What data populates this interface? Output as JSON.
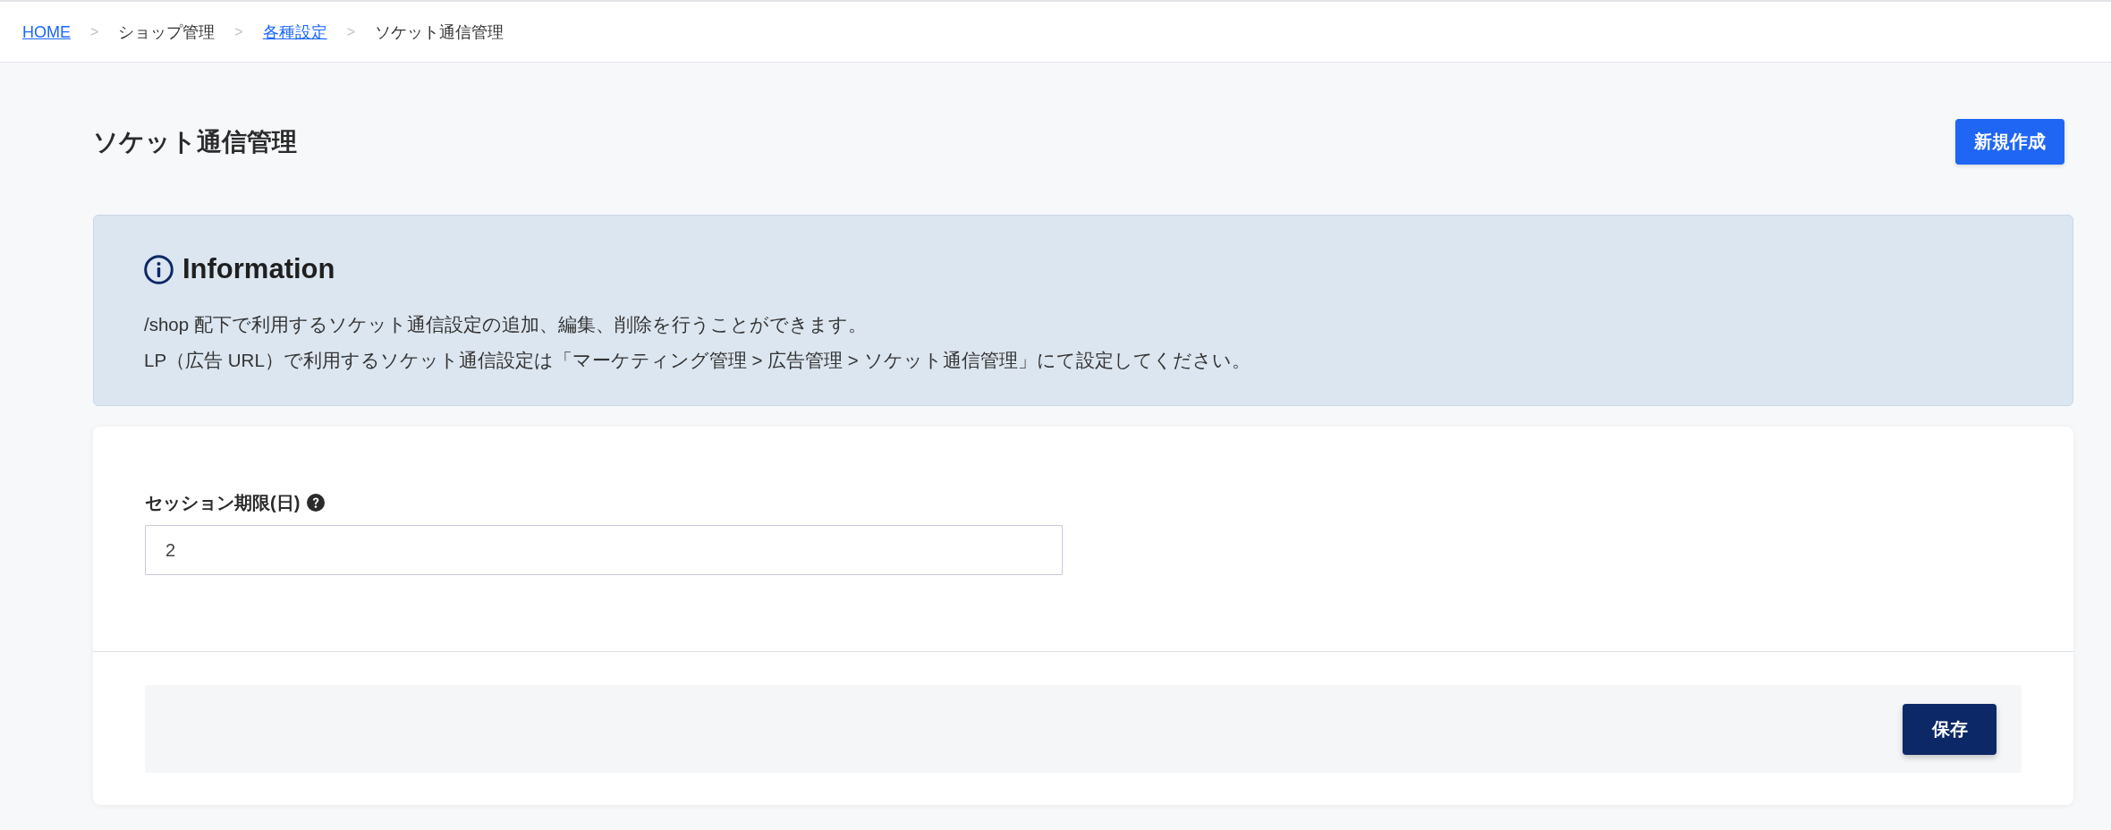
{
  "breadcrumb": [
    {
      "kind": "link",
      "label": "HOME"
    },
    {
      "kind": "separator",
      "label": ">"
    },
    {
      "kind": "text",
      "label": "ショップ管理"
    },
    {
      "kind": "separator",
      "label": ">"
    },
    {
      "kind": "link",
      "label": "各種設定"
    },
    {
      "kind": "separator",
      "label": ">"
    },
    {
      "kind": "text",
      "label": "ソケット通信管理"
    }
  ],
  "page": {
    "title": "ソケット通信管理",
    "new_button": "新規作成"
  },
  "info": {
    "title": "Information",
    "lines": [
      "/shop 配下で利用するソケット通信設定の追加、編集、削除を行うことができます。",
      "LP（広告 URL）で利用するソケット通信設定は「マーケティング管理 > 広告管理 > ソケット通信管理」にて設定してください。"
    ]
  },
  "form": {
    "fields": [
      {
        "label": "セッション期限(日)",
        "help": true,
        "value": "2"
      }
    ],
    "save_button": "保存"
  }
}
